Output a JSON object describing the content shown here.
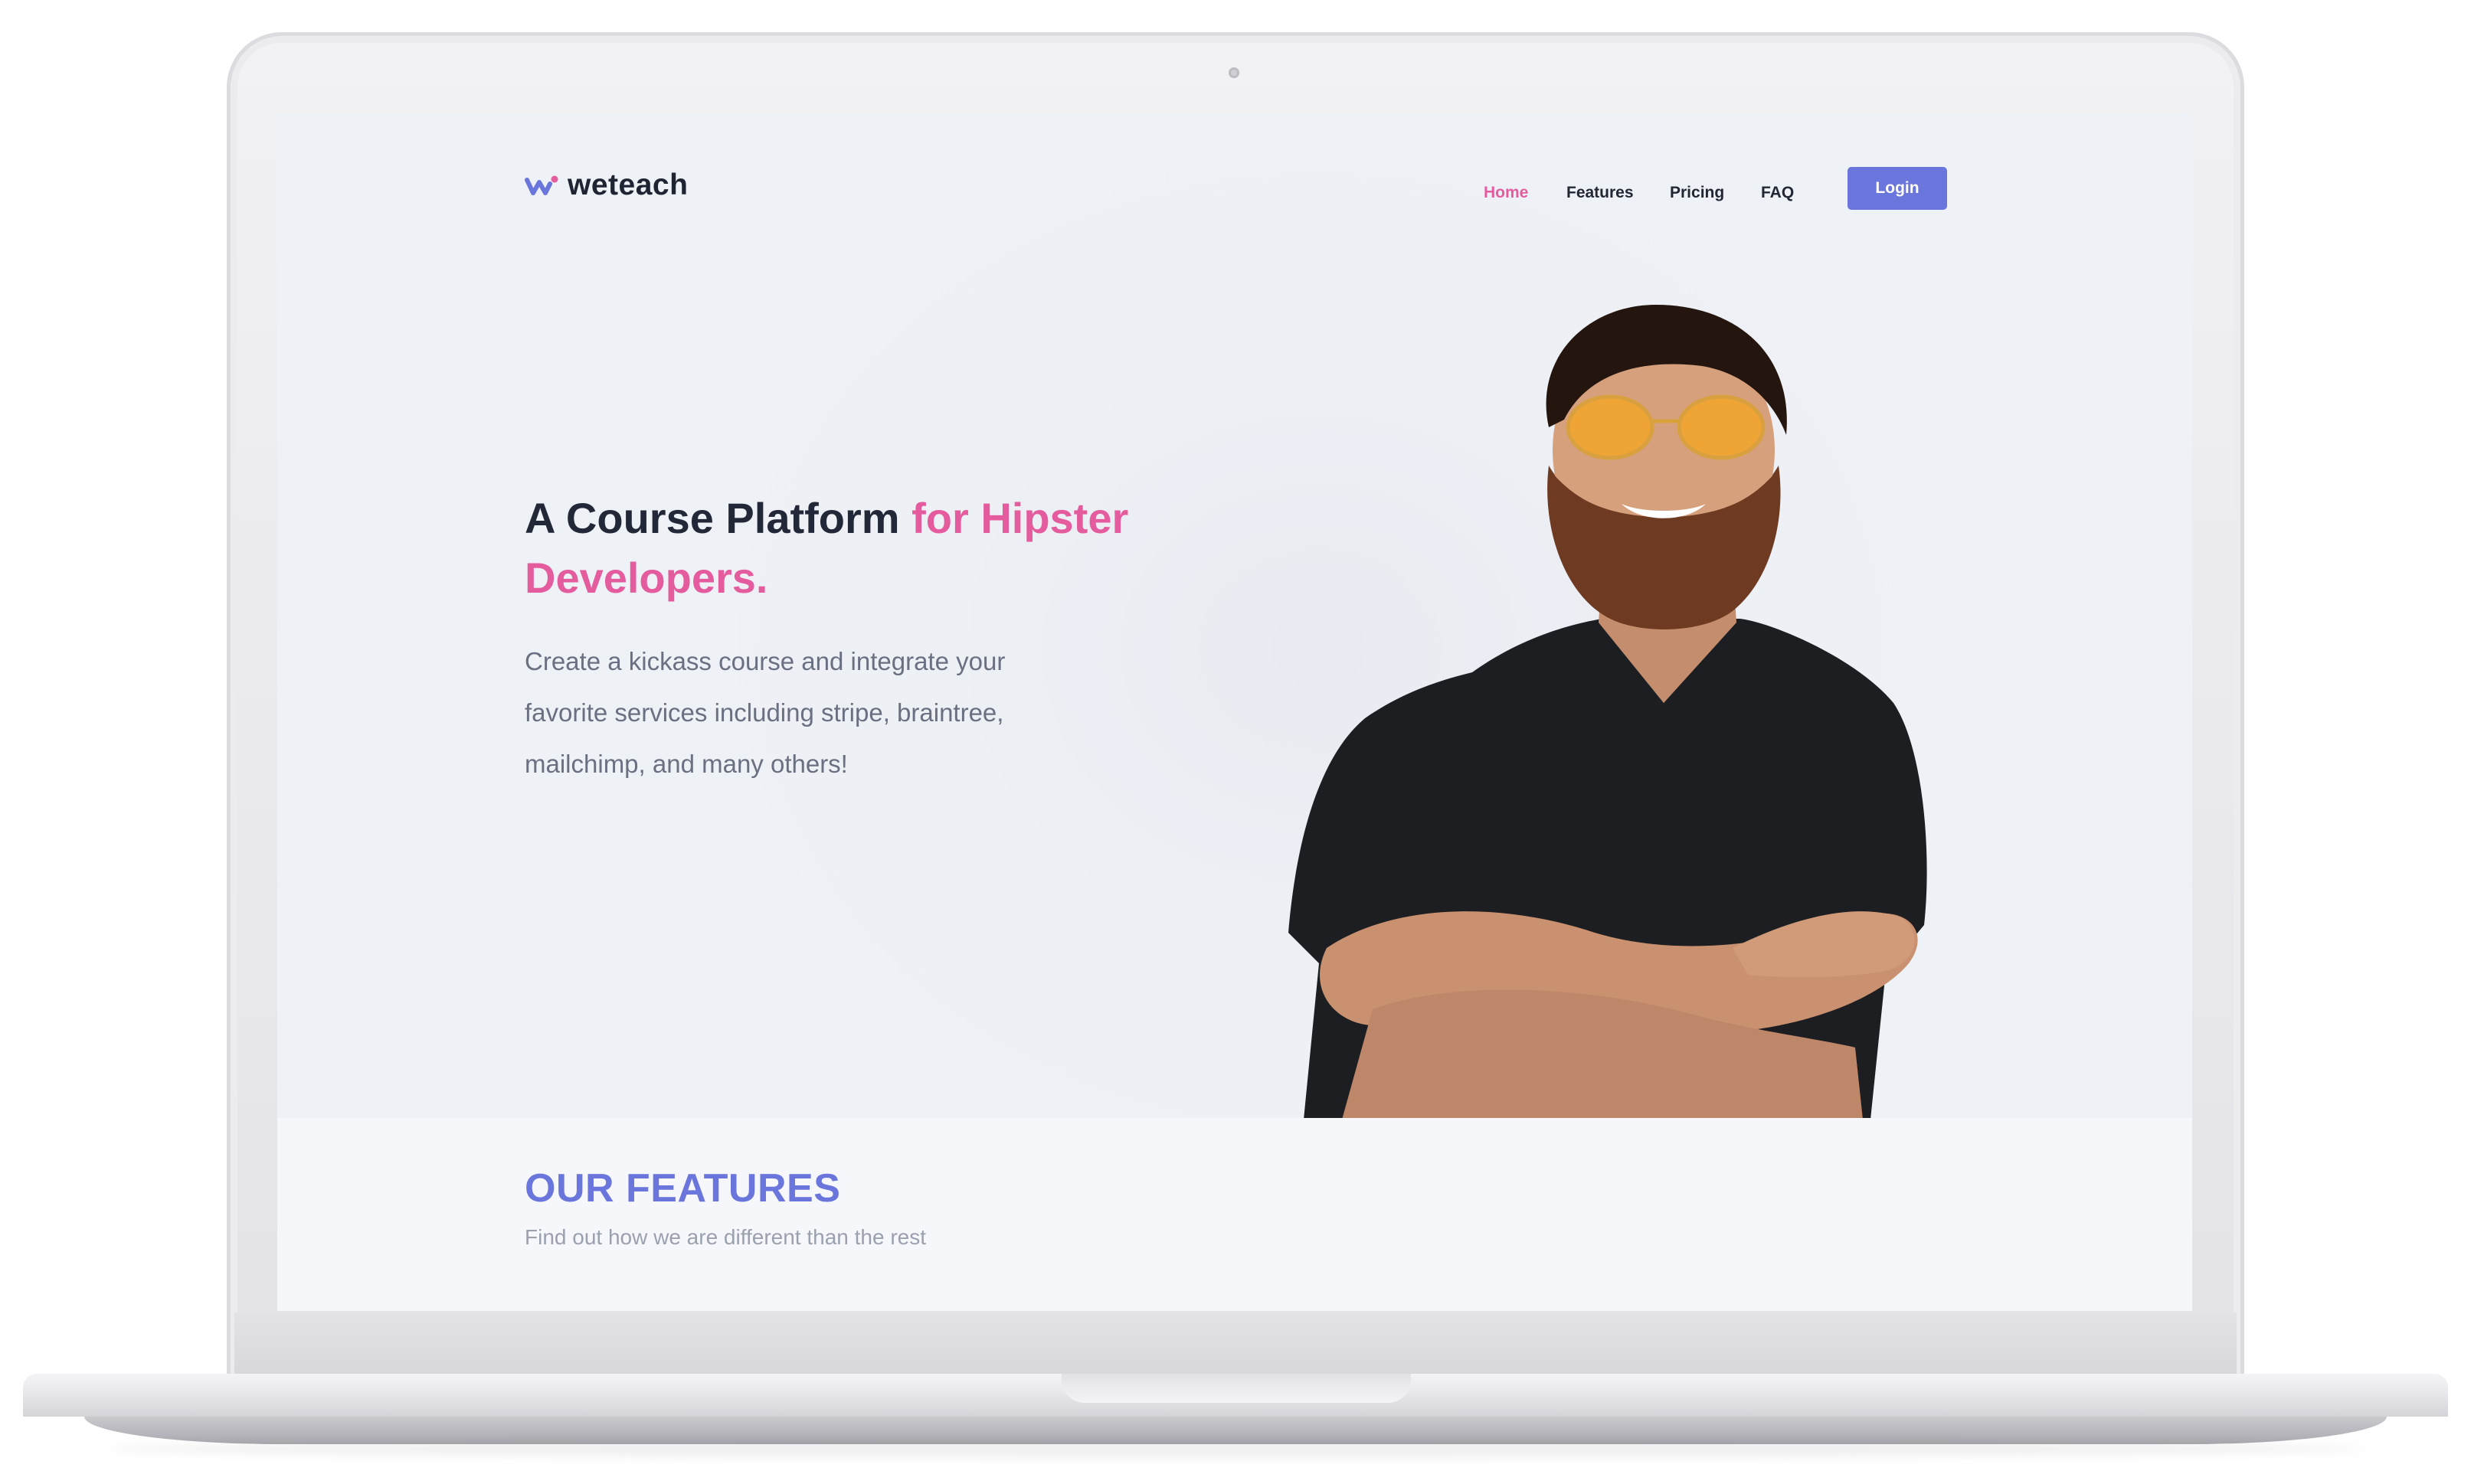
{
  "brand": {
    "name": "weteach",
    "icon": "w-logo-icon"
  },
  "nav": {
    "items": [
      {
        "label": "Home",
        "active": true
      },
      {
        "label": "Features",
        "active": false
      },
      {
        "label": "Pricing",
        "active": false
      },
      {
        "label": "FAQ",
        "active": false
      }
    ],
    "login_label": "Login"
  },
  "hero": {
    "headline_part1": "A Course Platform ",
    "headline_part2": "for Hipster",
    "headline_part3": "Developers.",
    "subtext": "Create a kickass course and integrate your favorite services including stripe, braintree, mailchimp, and many others!"
  },
  "features": {
    "title": "OUR FEATURES",
    "subtitle": "Find out how we are different than the rest"
  },
  "colors": {
    "accent_pink": "#e45c9d",
    "accent_blue": "#6b76dd",
    "hero_bg": "#eef1f6",
    "features_bg": "#f6f7fb",
    "heading": "#232838",
    "body_text": "#6a7081"
  }
}
